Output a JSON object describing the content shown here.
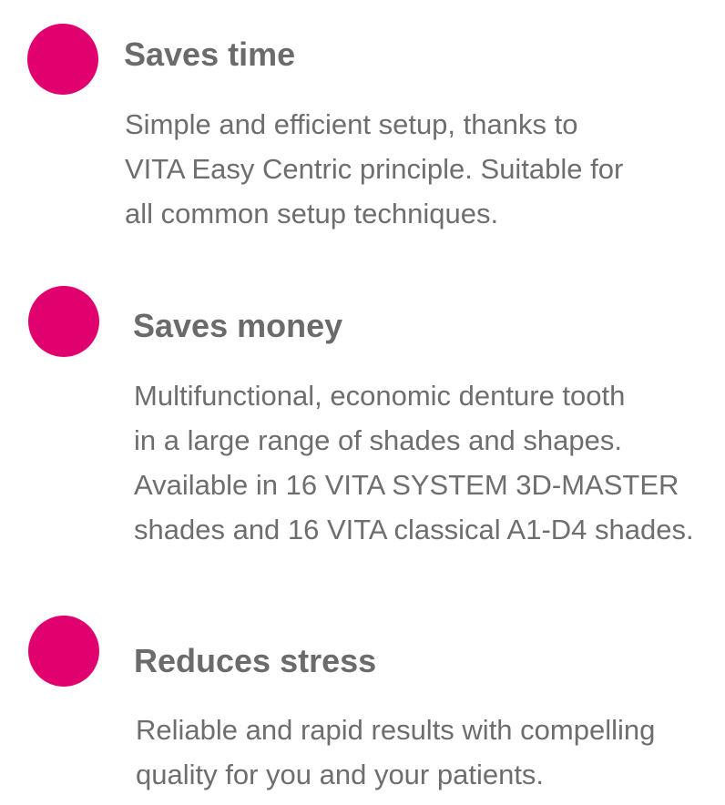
{
  "accent_color": "#e0006e",
  "features": [
    {
      "icon": "pink-circle-icon",
      "title": "Saves time",
      "text": "Simple and efficient setup, thanks to\nVITA Easy Centric principle. Suitable for\nall common setup techniques."
    },
    {
      "icon": "pink-circle-icon",
      "title": "Saves money",
      "text": "Multifunctional, economic denture tooth\nin a large range of shades and shapes.\nAvailable in 16 VITA SYSTEM 3D-MASTER\nshades and 16 VITA classical A1-D4 shades."
    },
    {
      "icon": "pink-circle-icon",
      "title": "Reduces stress",
      "text": "Reliable and rapid results with compelling\nquality for you and your patients."
    }
  ]
}
